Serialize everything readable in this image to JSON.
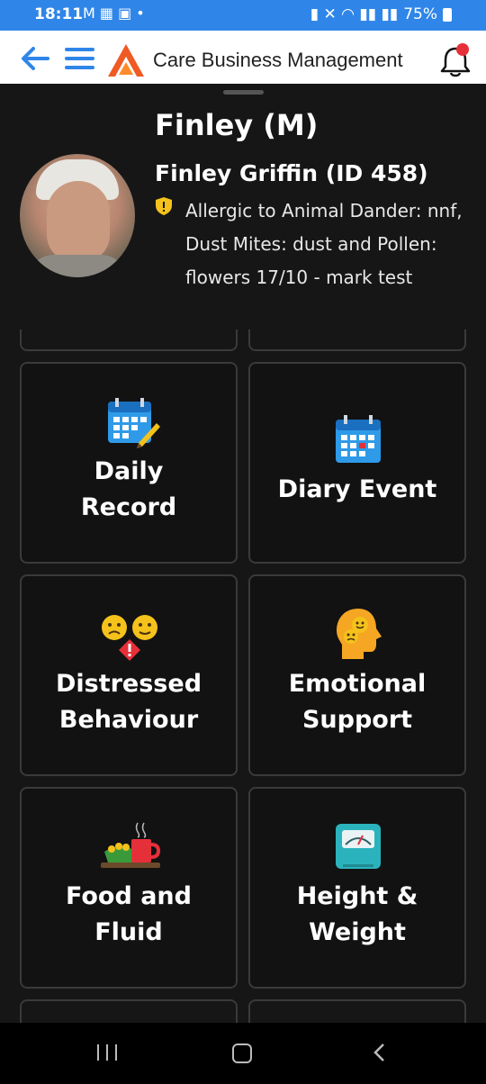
{
  "status": {
    "time": "18:11",
    "left_icons": "M ▦ ▣ •",
    "battery": "75%"
  },
  "header": {
    "title": "Care Business Management"
  },
  "profile": {
    "short_name": "Finley (M)",
    "full_name": "Finley Griffin (ID 458)",
    "allergy_note": "Allergic to Animal Dander: nnf, Dust Mites: dust and Pollen: flowers 17/10 - mark test"
  },
  "tiles": [
    {
      "line1": "Daily",
      "line2": "Record",
      "icon": "calendar-pencil-icon"
    },
    {
      "line1": "Diary Event",
      "line2": "",
      "icon": "calendar-icon"
    },
    {
      "line1": "Distressed",
      "line2": "Behaviour",
      "icon": "worried-faces-icon"
    },
    {
      "line1": "Emotional",
      "line2": "Support",
      "icon": "head-emotions-icon"
    },
    {
      "line1": "Food and",
      "line2": "Fluid",
      "icon": "food-drink-icon"
    },
    {
      "line1": "Height &",
      "line2": "Weight",
      "icon": "scale-icon"
    }
  ],
  "colors": {
    "accent": "#2f86e8",
    "background": "#161616",
    "tile_border": "#3a3a3a",
    "warning": "#f4c21b",
    "notification": "#e5303a"
  }
}
